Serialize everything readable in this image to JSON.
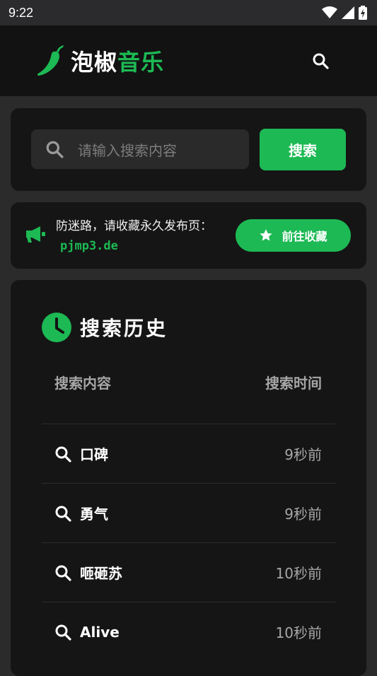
{
  "status": {
    "time": "9:22"
  },
  "header": {
    "brand_white": "泡椒",
    "brand_green": "音乐"
  },
  "search": {
    "placeholder": "请输入搜索内容",
    "button": "搜索"
  },
  "notice": {
    "text": "防迷路，请收藏永久发布页：",
    "url": "pjmp3.de",
    "button": "前往收藏"
  },
  "history": {
    "title": "搜索历史",
    "col_query": "搜索内容",
    "col_time": "搜索时间",
    "items": [
      {
        "query": "口碑",
        "time": "9秒前"
      },
      {
        "query": "勇气",
        "time": "9秒前"
      },
      {
        "query": "咂砸苏",
        "time": "10秒前"
      },
      {
        "query": "Alive",
        "time": "10秒前"
      }
    ]
  },
  "colors": {
    "accent": "#1db954",
    "background": "#2b2b2b",
    "card": "#151515",
    "header": "#121212"
  }
}
